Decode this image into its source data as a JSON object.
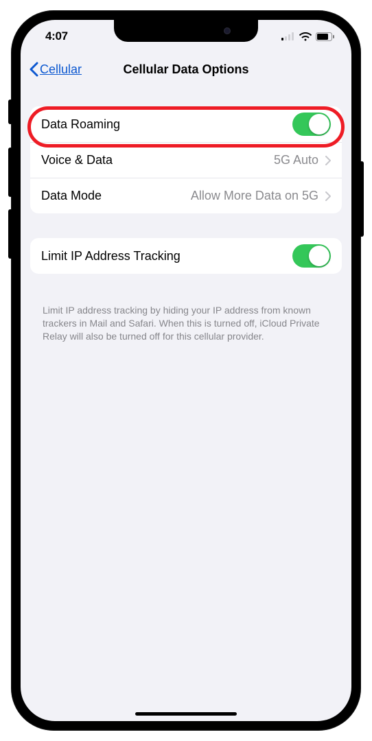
{
  "status": {
    "time": "4:07"
  },
  "nav": {
    "back_label": "Cellular",
    "title": "Cellular Data Options"
  },
  "group1": {
    "data_roaming": {
      "label": "Data Roaming",
      "on": true
    },
    "voice_data": {
      "label": "Voice & Data",
      "value": "5G Auto"
    },
    "data_mode": {
      "label": "Data Mode",
      "value": "Allow More Data on 5G"
    }
  },
  "group2": {
    "limit_ip": {
      "label": "Limit IP Address Tracking",
      "on": true
    }
  },
  "footer": "Limit IP address tracking by hiding your IP address from known trackers in Mail and Safari. When this is turned off, iCloud Private Relay will also be turned off for this cellular provider."
}
